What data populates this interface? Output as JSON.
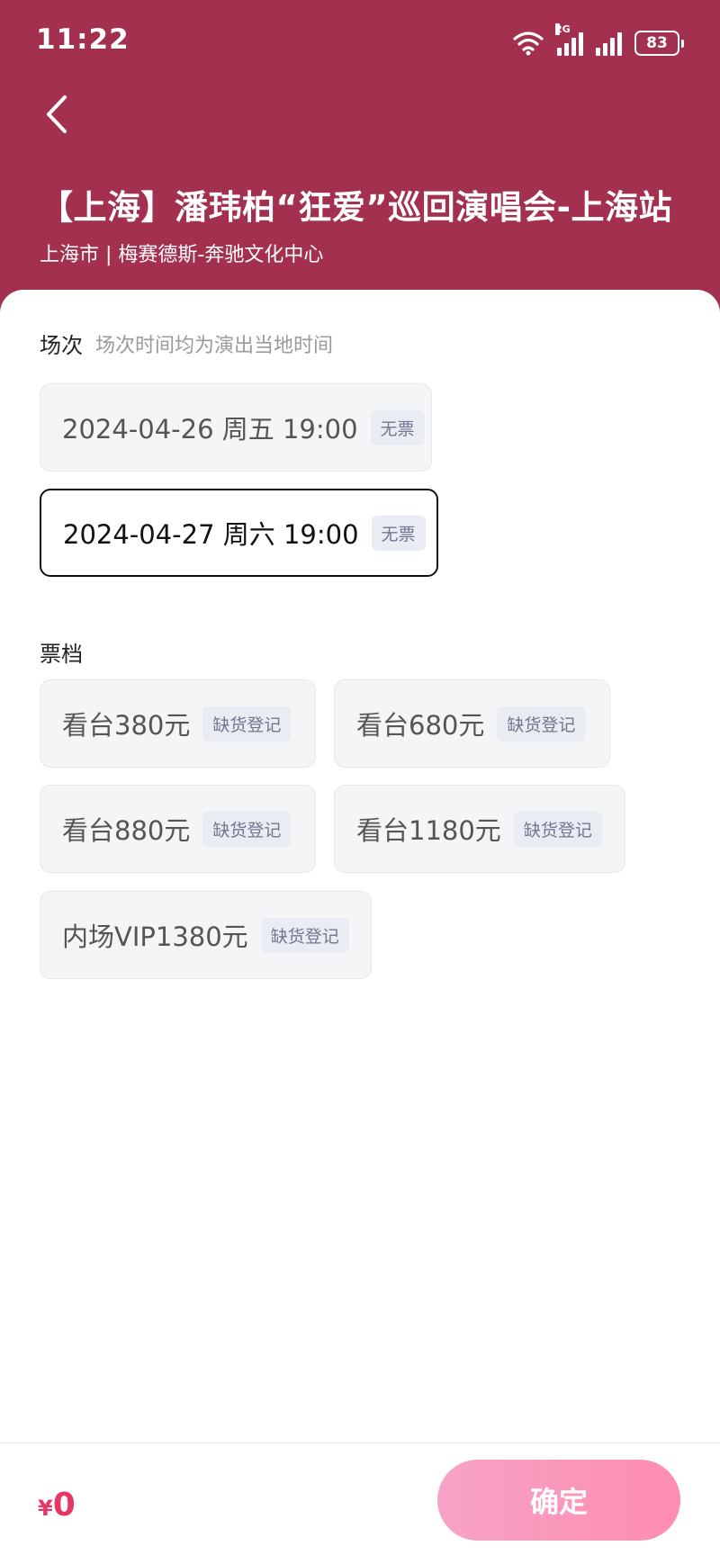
{
  "status_bar": {
    "time": "11:22",
    "network": "2G",
    "battery": "83"
  },
  "event": {
    "title": "【上海】潘玮柏“狂爱”巡回演唱会-上海站",
    "venue": "上海市 | 梅赛德斯-奔驰文化中心"
  },
  "sessions": {
    "label": "场次",
    "note": "场次时间均为演出当地时间",
    "items": [
      {
        "text": "2024-04-26 周五 19:00",
        "tag": "无票",
        "selected": false
      },
      {
        "text": "2024-04-27  周六 19:00",
        "tag": "无票",
        "selected": true
      }
    ]
  },
  "tickets": {
    "label": "票档",
    "items": [
      {
        "text": "看台380元",
        "tag": "缺货登记"
      },
      {
        "text": "看台680元",
        "tag": "缺货登记"
      },
      {
        "text": "看台880元",
        "tag": "缺货登记"
      },
      {
        "text": "看台1180元",
        "tag": "缺货登记"
      },
      {
        "text": "内场VIP1380元",
        "tag": "缺货登记"
      }
    ]
  },
  "footer": {
    "currency": "¥",
    "amount": "0",
    "confirm_label": "确定"
  },
  "colors": {
    "header": "#a3304f",
    "price": "#e73565",
    "confirm_start": "#f6a3c6",
    "confirm_end": "#fe8db0"
  },
  "icons": [
    "back-arrow-icon",
    "wifi-icon",
    "signal-icon",
    "battery-icon"
  ]
}
